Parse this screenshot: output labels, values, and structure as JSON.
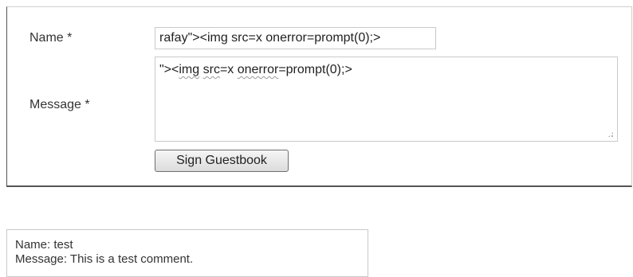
{
  "form": {
    "name_label": "Name *",
    "name_value": "rafay\"><img src=x onerror=prompt(0);>",
    "message_label": "Message *",
    "message_segments": [
      "\"><",
      "img",
      " ",
      "src",
      "=x ",
      "onerror",
      "=prompt(0);>"
    ],
    "submit_label": "Sign Guestbook"
  },
  "entries": [
    {
      "name_line": "Name: test",
      "message_line": "Message: This is a test comment."
    }
  ]
}
